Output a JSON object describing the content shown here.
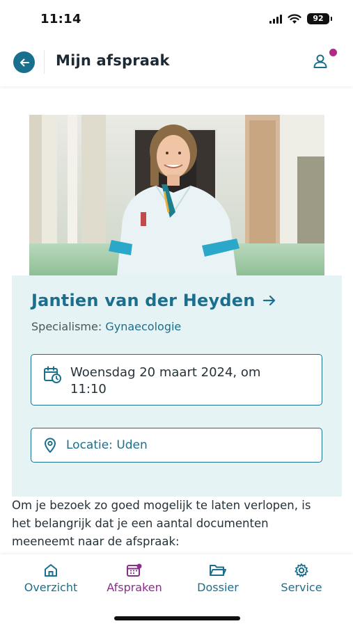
{
  "status_bar": {
    "time": "11:14",
    "battery": "92"
  },
  "header": {
    "title": "Mijn afspraak",
    "back_icon": "arrow-left-icon",
    "profile_icon": "user-icon",
    "notification_color": "#b02a87"
  },
  "photo": {
    "subject": "doctor-portrait"
  },
  "appointment": {
    "doctor_name": "Jantien van der Heyden",
    "specialism_label": "Specialisme: ",
    "specialism_value": "Gynaecologie",
    "date_line1": "Woensdag 20 maart 2024, om",
    "date_line2": "11:10",
    "location": "Locatie: Uden"
  },
  "intro": {
    "line1": "Om je bezoek zo goed mogelijk te laten verlopen, is",
    "line2": "het belangrijk dat je een aantal documenten",
    "line3": "meeneemt naar de afspraak:"
  },
  "bottom_nav": {
    "items": [
      {
        "label": "Overzicht",
        "icon": "home-icon",
        "active": false
      },
      {
        "label": "Afspraken",
        "icon": "calendar-icon",
        "active": true
      },
      {
        "label": "Dossier",
        "icon": "folder-icon",
        "active": false
      },
      {
        "label": "Service",
        "icon": "gear-icon",
        "active": false
      }
    ]
  },
  "colors": {
    "primary": "#1b6f8e",
    "accent": "#8a2e8c",
    "card_background": "#e6f3f5"
  }
}
